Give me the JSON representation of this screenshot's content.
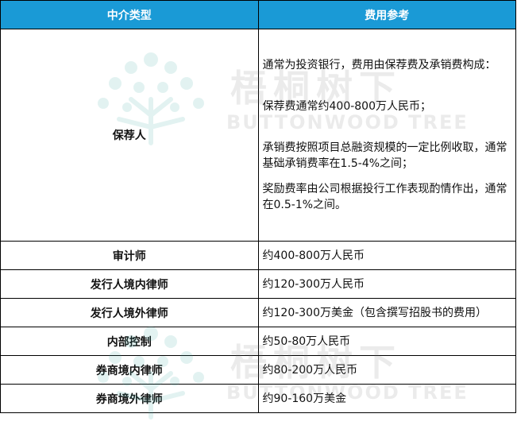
{
  "table": {
    "headers": [
      "中介类型",
      "费用参考"
    ],
    "rows": [
      {
        "type": "保荐人",
        "ref": [
          "通常为投资银行，费用由保荐费及承销费构成：",
          "保荐费通常约400-800万人民币；",
          "承销费按照项目总融资规模的一定比例收取，通常基础承销费率在1.5-4%之间；",
          "奖励费率由公司根据投行工作表现酌情作出，通常在0.5-1%之间。"
        ]
      },
      {
        "type": "审计师",
        "ref": [
          "约400-800万人民币"
        ]
      },
      {
        "type": "发行人境内律师",
        "ref": [
          "约120-300万人民币"
        ]
      },
      {
        "type": "发行人境外律师",
        "ref": [
          "约120-300万美金（包含撰写招股书的费用）"
        ]
      },
      {
        "type": "内部控制",
        "ref": [
          "约50-80万人民币"
        ]
      },
      {
        "type": "券商境内律师",
        "ref": [
          "约80-200万人民币"
        ]
      },
      {
        "type": "券商境外律师",
        "ref": [
          "约90-160万美金"
        ]
      }
    ]
  },
  "watermark": {
    "cn": "梧桐树下",
    "en": "BUTTONWOOD TREE"
  },
  "colors": {
    "header_bg": "#1a9ad6",
    "header_text": "#ffffff",
    "border": "#000000"
  }
}
